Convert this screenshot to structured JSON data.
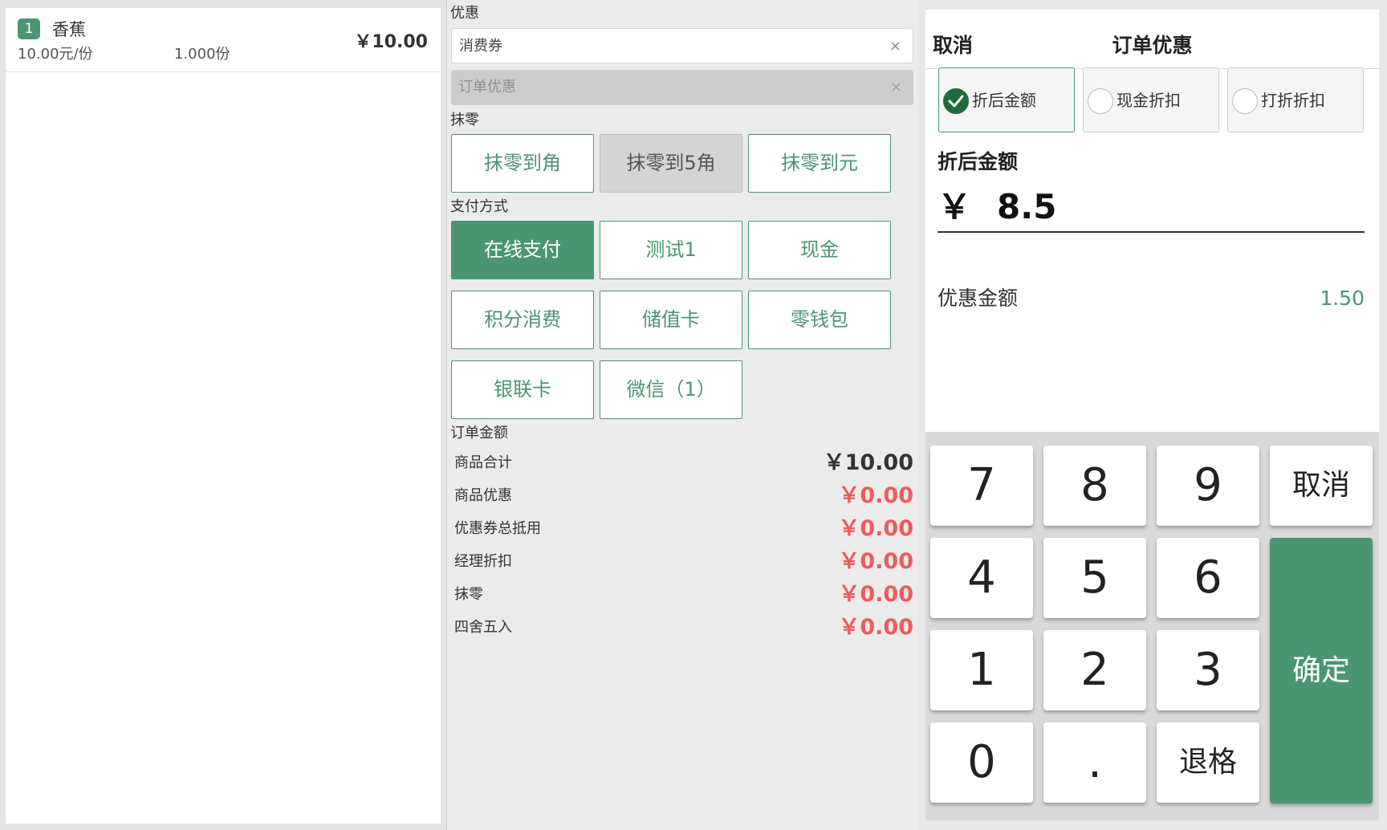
{
  "order": {
    "items": [
      {
        "index": "1",
        "name": "香蕉",
        "unit_price": "10.00元/份",
        "quantity": "1.000份",
        "total": "￥10.00"
      }
    ]
  },
  "discount": {
    "section_label": "优惠",
    "coupon": {
      "value": "消费券",
      "clear": "×"
    },
    "order_discount": {
      "value": "订单优惠",
      "clear": "×"
    }
  },
  "rounding": {
    "section_label": "抹零",
    "buttons": [
      "抹零到角",
      "抹零到5角",
      "抹零到元"
    ]
  },
  "payment": {
    "section_label": "支付方式",
    "methods": [
      "在线支付",
      "测试1",
      "现金",
      "积分消费",
      "储值卡",
      "零钱包",
      "银联卡",
      "微信（1）"
    ]
  },
  "summary": {
    "section_label": "订单金额",
    "rows": [
      {
        "label": "商品合计",
        "value": "￥10.00"
      },
      {
        "label": "商品优惠",
        "value": "￥0.00"
      },
      {
        "label": "优惠券总抵用",
        "value": "￥0.00"
      },
      {
        "label": "经理折扣",
        "value": "￥0.00"
      },
      {
        "label": "抹零",
        "value": "￥0.00"
      },
      {
        "label": "四舍五入",
        "value": "￥0.00"
      }
    ]
  },
  "dialog": {
    "cancel_label": "取消",
    "title": "订单优惠",
    "modes": [
      "折后金额",
      "现金折扣",
      "打折折扣"
    ],
    "selected_mode": "折后金额",
    "amount_label": "折后金额",
    "currency": "￥",
    "amount_value": "8.5",
    "discount_label": "优惠金额",
    "discount_value": "1.50"
  },
  "keypad": {
    "keys": [
      "7",
      "8",
      "9",
      "4",
      "5",
      "6",
      "1",
      "2",
      "3",
      "0",
      ".",
      "退格"
    ],
    "cancel_label": "取消",
    "confirm_label": "确定"
  },
  "colors": {
    "accent": "#4a9672",
    "negative": "#ef5b5b",
    "check": "#1f6b3a"
  }
}
